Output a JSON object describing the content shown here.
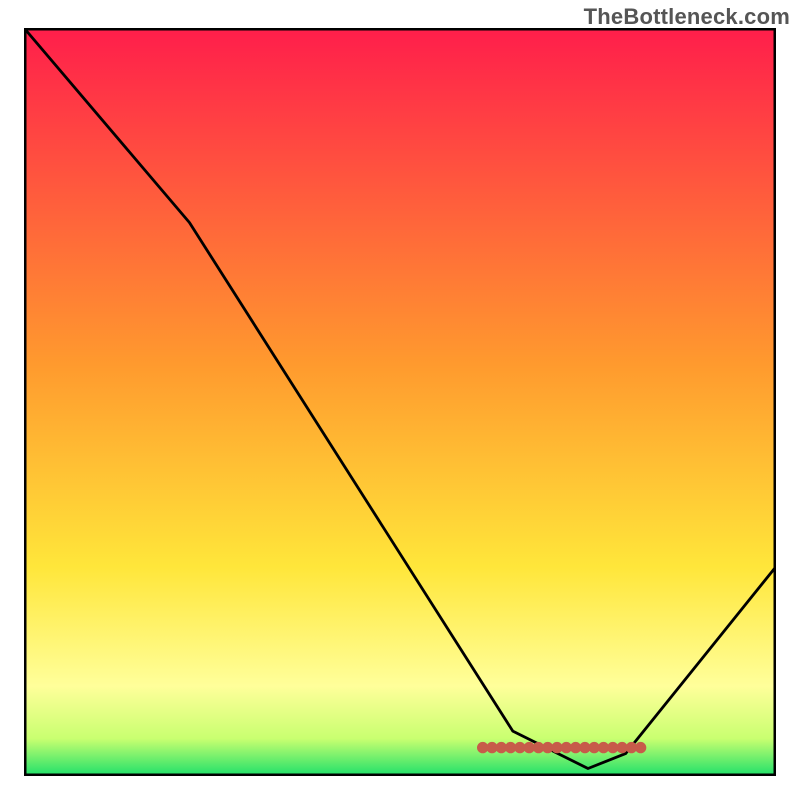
{
  "watermark": "TheBottleneck.com",
  "chart_data": {
    "type": "line",
    "title": "",
    "xlabel": "",
    "ylabel": "",
    "xlim": [
      0,
      100
    ],
    "ylim": [
      0,
      100
    ],
    "grid": false,
    "legend": false,
    "series": [
      {
        "name": "curve",
        "x": [
          0,
          22,
          65,
          75,
          80,
          100
        ],
        "values": [
          100,
          74,
          6,
          1,
          3,
          28
        ]
      }
    ],
    "gradient_stops": [
      {
        "pct": 0.0,
        "color": "#ff1e4b"
      },
      {
        "pct": 0.45,
        "color": "#ff9a2e"
      },
      {
        "pct": 0.72,
        "color": "#ffe63a"
      },
      {
        "pct": 0.88,
        "color": "#ffff9a"
      },
      {
        "pct": 0.95,
        "color": "#c9ff70"
      },
      {
        "pct": 1.0,
        "color": "#1ee06a"
      }
    ],
    "annotations": {
      "bottom_dot_band": {
        "x_start_frac": 0.61,
        "x_end_frac": 0.82,
        "y_frac": 0.962,
        "count": 18,
        "color": "#c75b4a"
      }
    }
  }
}
